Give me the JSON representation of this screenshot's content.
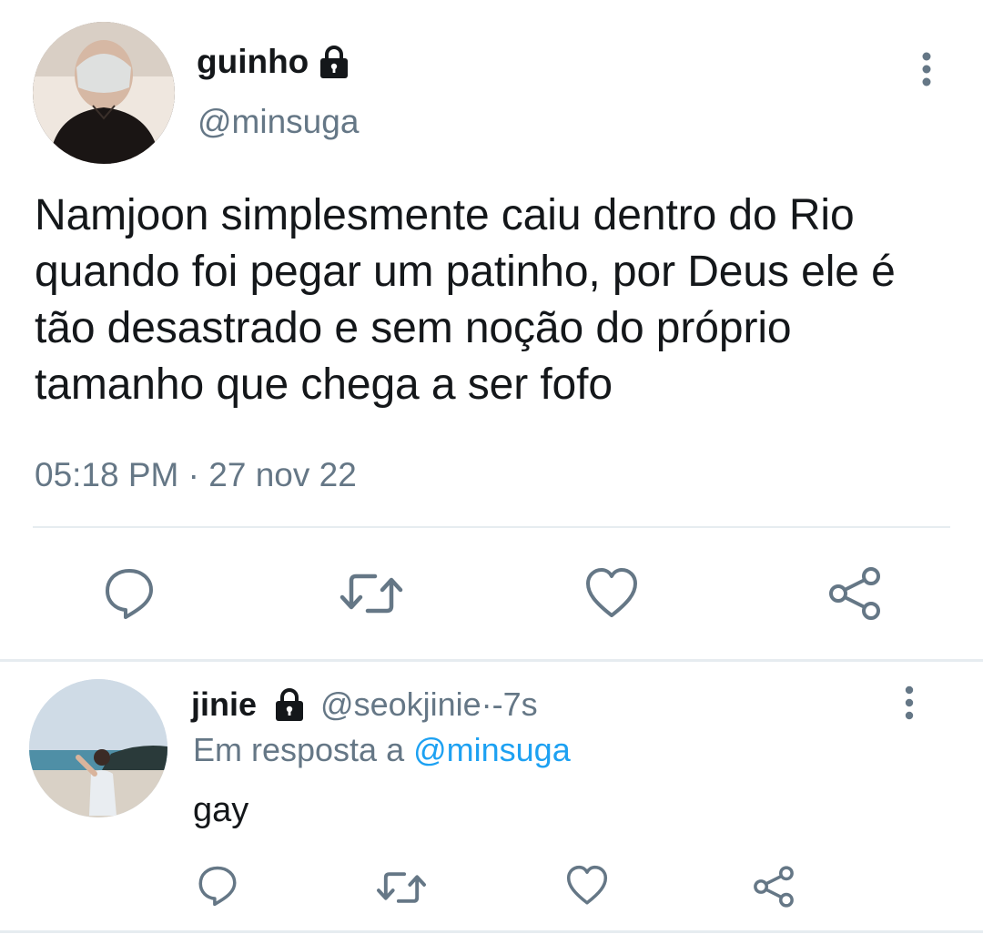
{
  "main_tweet": {
    "display_name": "guinho",
    "handle": "@minsuga",
    "text": "Namjoon simplesmente caiu dentro do Rio quando foi pegar um patinho, por Deus ele é tão desastrado e sem noção do próprio tamanho que chega a ser fofo",
    "time": "05:18 PM",
    "separator": " · ",
    "date": "27 nov 22",
    "icons": {
      "lock": "lock-icon",
      "more": "more-vertical-icon",
      "reply": "reply-icon",
      "retweet": "retweet-icon",
      "like": "like-icon",
      "share": "share-icon"
    }
  },
  "reply_tweet": {
    "display_name": "jinie",
    "handle": "@seokjinie",
    "time_separator": " · ",
    "time_ago": "-7s",
    "replying_to_label": "Em resposta a ",
    "replying_to_handle": "@minsuga",
    "text": "gay"
  },
  "colors": {
    "text_primary": "#14171a",
    "text_secondary": "#657786",
    "link_blue": "#1da1f2",
    "divider": "#e6ecf0",
    "icon_gray": "#657786"
  }
}
